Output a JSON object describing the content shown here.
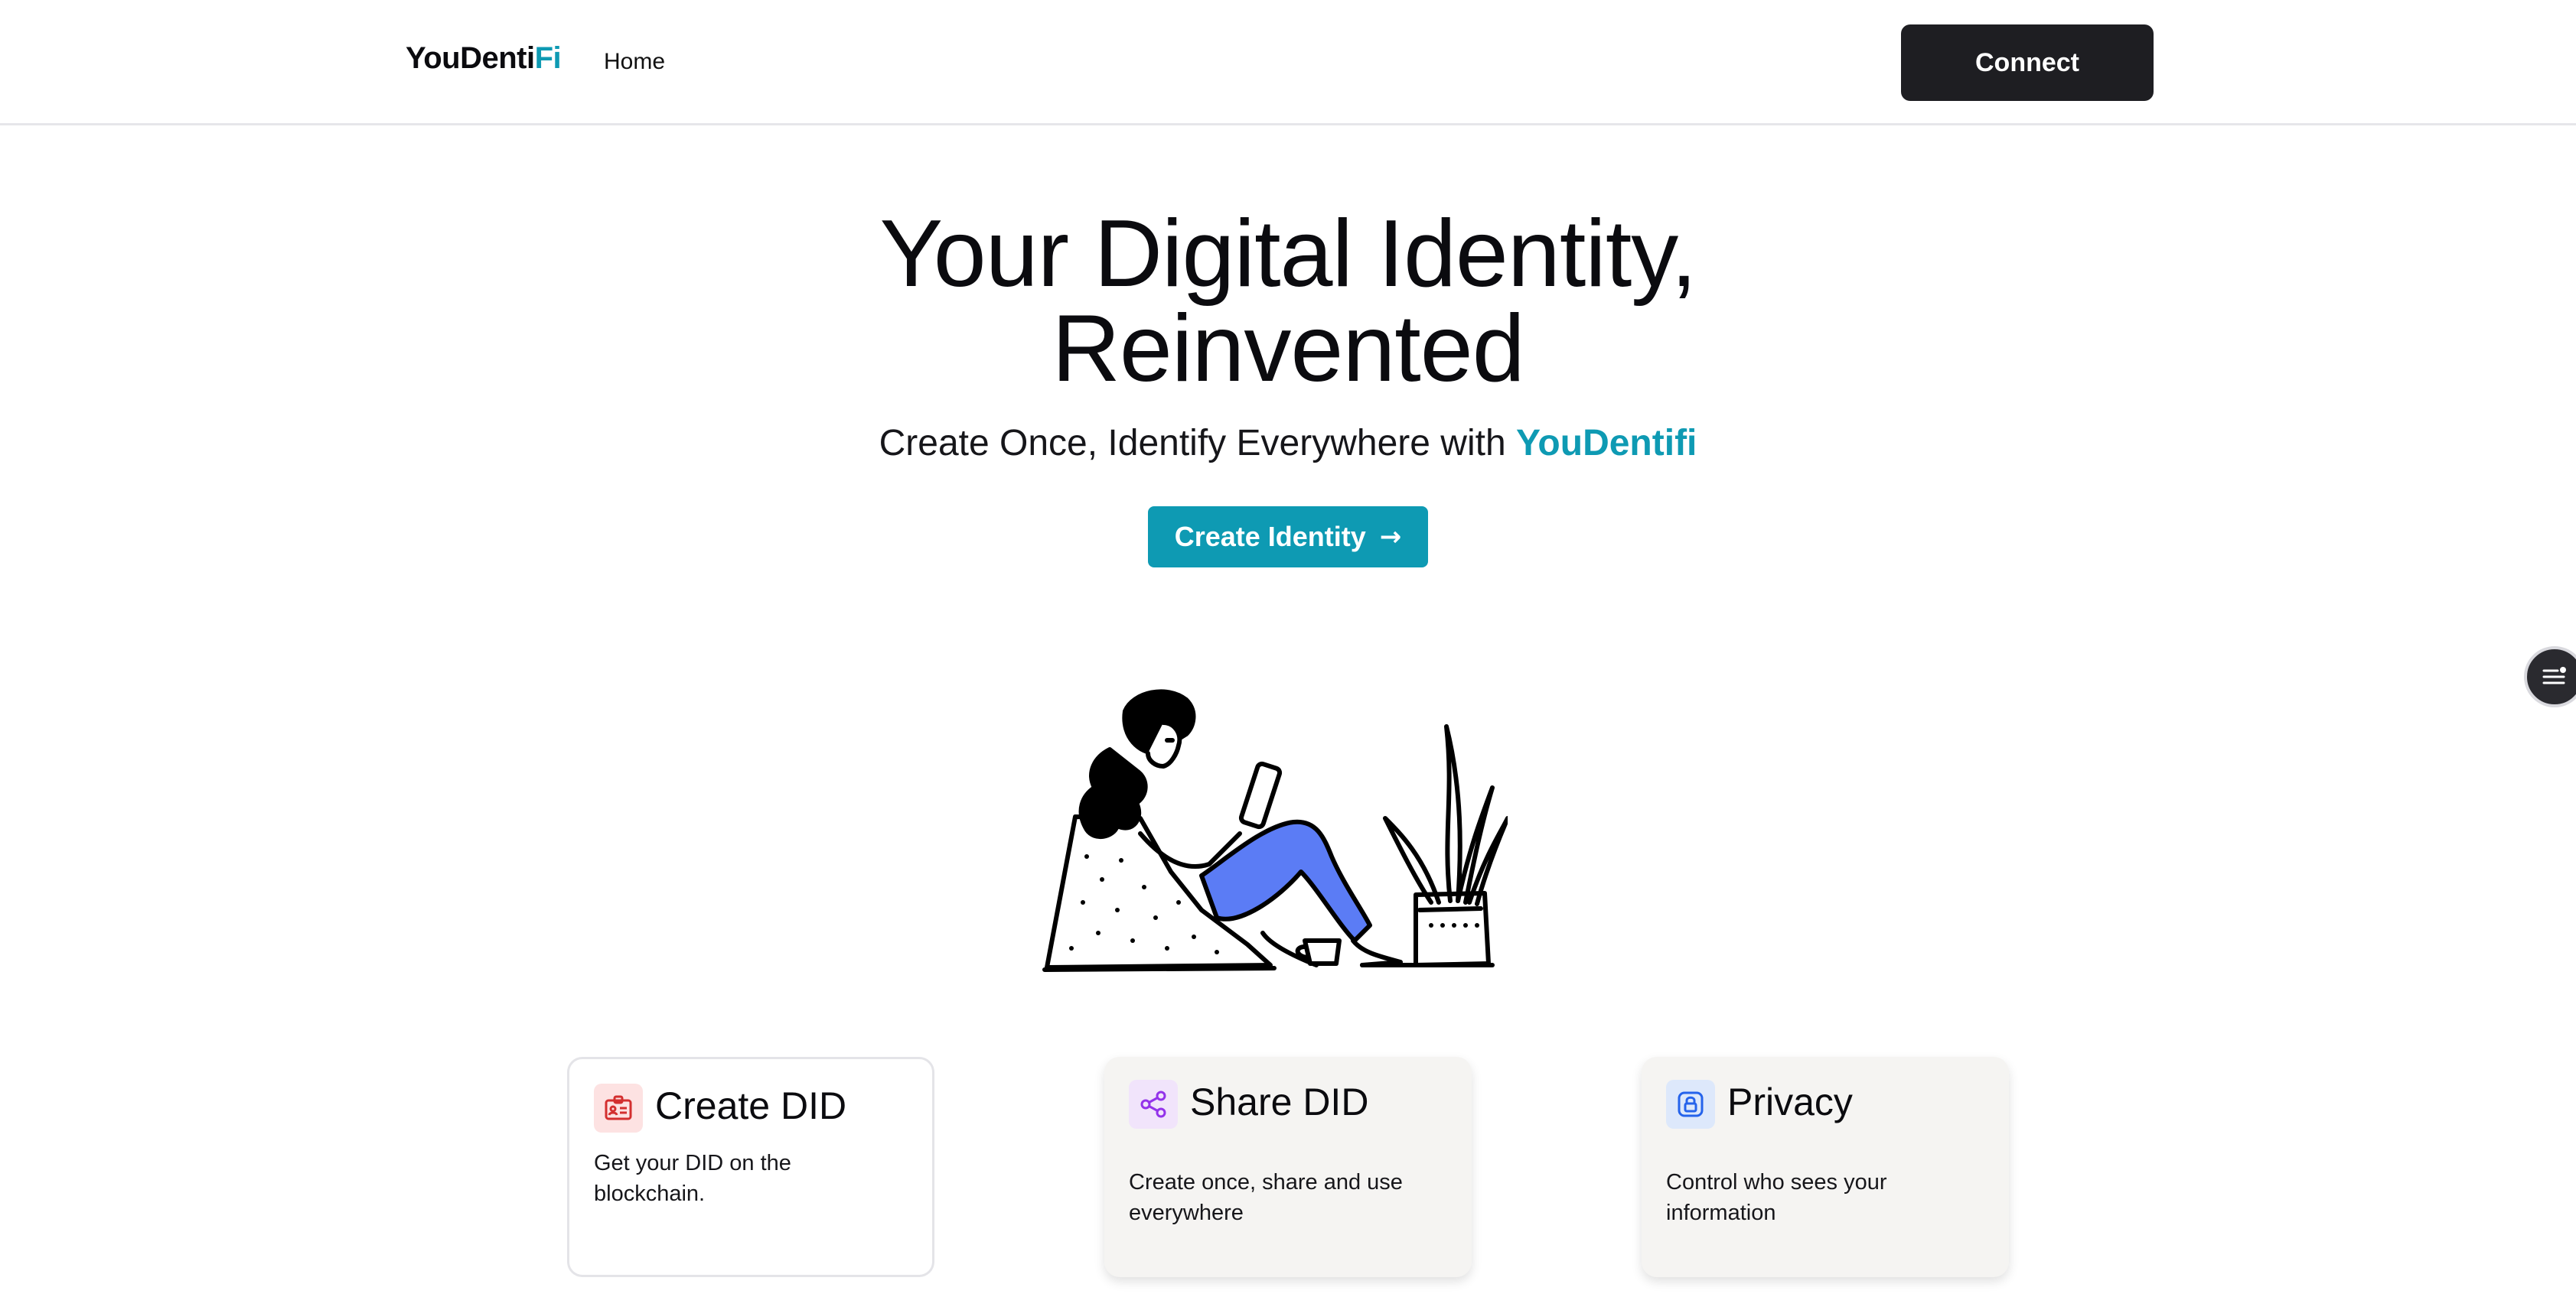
{
  "header": {
    "brand_main": "YouDenti",
    "brand_accent": "Fi",
    "nav_home": "Home",
    "connect_label": "Connect"
  },
  "hero": {
    "title_line1": "Your Digital Identity,",
    "title_line2": "Reinvented",
    "subtitle_prefix": "Create Once, Identify Everywhere with ",
    "subtitle_brand": "YouDentifi",
    "cta_label": "Create Identity",
    "cta_icon": "arrow-right-icon"
  },
  "features": [
    {
      "title": "Create DID",
      "description": "Get your DID on the blockchain.",
      "icon": "id-card-icon",
      "icon_color": "#d32f2f",
      "icon_bg": "#fde2e2"
    },
    {
      "title": "Share DID",
      "description": "Create once, share and use everywhere",
      "icon": "share-icon",
      "icon_color": "#9333ea",
      "icon_bg": "#f1e4fb"
    },
    {
      "title": "Privacy",
      "description": "Control who sees your information",
      "icon": "lock-icon",
      "icon_color": "#2563eb",
      "icon_bg": "#dde8fb"
    }
  ],
  "colors": {
    "accent": "#0e9ab3",
    "dark": "#1e1e22",
    "pants": "#5b7cf5"
  }
}
